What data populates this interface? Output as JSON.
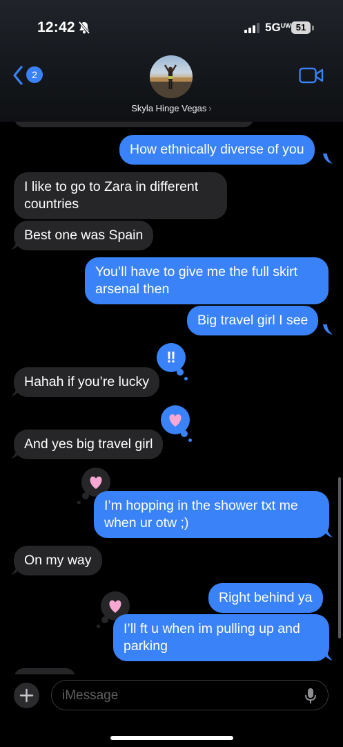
{
  "status_bar": {
    "time": "12:42",
    "network": "5G",
    "network_sub": "UW",
    "battery": "51"
  },
  "header": {
    "back_count": "2",
    "contact_name": "Skyla Hinge Vegas",
    "chevron": "›"
  },
  "messages": [
    {
      "dir": "out",
      "text": "How ethnically diverse of you"
    },
    {
      "dir": "in",
      "text": "I like to go to Zara in different countries"
    },
    {
      "dir": "in",
      "text": "Best one was Spain"
    },
    {
      "dir": "out",
      "text": "You’ll have to give me the full skirt arsenal then"
    },
    {
      "dir": "out",
      "text": "Big travel girl I see"
    },
    {
      "dir": "in",
      "text": "Hahah if you’re lucky",
      "reaction": "‼"
    },
    {
      "dir": "in",
      "text": "And yes big travel girl",
      "reaction": "heart"
    },
    {
      "dir": "out",
      "text": "I’m hopping in the shower txt me when ur otw ;)",
      "reaction": "heart"
    },
    {
      "dir": "in",
      "text": "On my way"
    },
    {
      "dir": "out",
      "text": "Right behind ya"
    },
    {
      "dir": "out",
      "text": "I’ll ft u when im pulling up and parking",
      "reaction": "heart"
    }
  ],
  "composer": {
    "placeholder": "iMessage"
  },
  "colors": {
    "outgoing": "#3a82f7",
    "incoming": "#262628",
    "background": "#000000"
  },
  "icons": [
    "bell-slash-icon",
    "signal-icon",
    "battery-icon",
    "back-chevron-icon",
    "video-camera-icon",
    "plus-icon",
    "microphone-icon",
    "heart-icon",
    "double-exclamation-icon"
  ]
}
